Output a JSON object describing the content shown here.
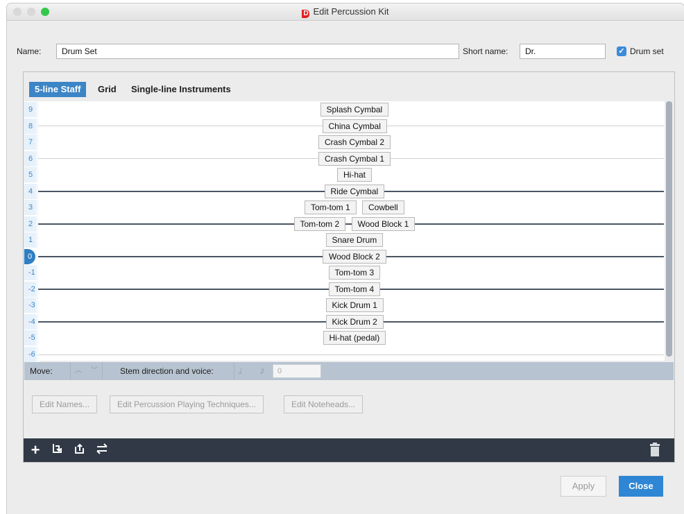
{
  "window": {
    "title": "Edit Percussion Kit",
    "traffic_colors": [
      "#d8d8d8",
      "#d8d8d8",
      "#34c84a"
    ]
  },
  "form": {
    "name_label": "Name:",
    "name_value": "Drum Set",
    "short_label": "Short name:",
    "short_value": "Dr.",
    "drumset_label": "Drum set",
    "drumset_checked": true
  },
  "tabs": [
    {
      "label": "5-line Staff",
      "active": true
    },
    {
      "label": "Grid",
      "active": false
    },
    {
      "label": "Single-line Instruments",
      "active": false
    }
  ],
  "staff": {
    "positions": [
      "9",
      "8",
      "7",
      "6",
      "5",
      "4",
      "3",
      "2",
      "1",
      "0",
      "-1",
      "-2",
      "-3",
      "-4",
      "-5",
      "-6"
    ],
    "selected_position": "0",
    "instruments": [
      {
        "label": "Splash Cymbal",
        "pos": "9"
      },
      {
        "label": "China Cymbal",
        "pos": "8"
      },
      {
        "label": "Crash Cymbal 2",
        "pos": "7"
      },
      {
        "label": "Crash Cymbal 1",
        "pos": "6"
      },
      {
        "label": "Hi-hat",
        "pos": "5"
      },
      {
        "label": "Ride Cymbal",
        "pos": "4"
      },
      {
        "label": "Tom-tom 1",
        "pos": "3"
      },
      {
        "label": "Cowbell",
        "pos": "3"
      },
      {
        "label": "Tom-tom 2",
        "pos": "2"
      },
      {
        "label": "Wood Block 1",
        "pos": "2"
      },
      {
        "label": "Snare Drum",
        "pos": "1"
      },
      {
        "label": "Wood Block 2",
        "pos": "0"
      },
      {
        "label": "Tom-tom 3",
        "pos": "-1"
      },
      {
        "label": "Tom-tom 4",
        "pos": "-2"
      },
      {
        "label": "Kick Drum 1",
        "pos": "-3"
      },
      {
        "label": "Kick Drum 2",
        "pos": "-4"
      },
      {
        "label": "Hi-hat (pedal)",
        "pos": "-5"
      }
    ]
  },
  "movebar": {
    "move_label": "Move:",
    "up_icon": "chevron-up-icon",
    "down_icon": "chevron-down-icon",
    "stem_label": "Stem direction and voice:",
    "voice_value": "0"
  },
  "buttons": {
    "edit_names": "Edit Names...",
    "edit_techniques": "Edit Percussion Playing Techniques...",
    "edit_noteheads": "Edit Noteheads...",
    "apply": "Apply",
    "close": "Close"
  },
  "toolbar": {
    "icons": [
      "plus-icon",
      "import-icon",
      "export-icon",
      "swap-icon",
      "trash-icon"
    ]
  },
  "colors": {
    "accent": "#2f86d4",
    "toolbar_bg": "#313946",
    "movebar_bg": "#b7c3d0"
  }
}
